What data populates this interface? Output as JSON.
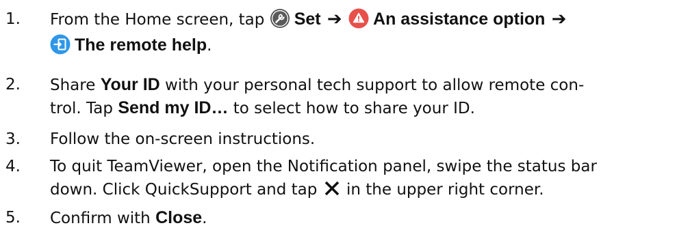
{
  "steps": [
    {
      "number": "1.",
      "line1_prefix": "From the Home screen, tap ",
      "set_label": "Set",
      "assistance_label": "An assistance option",
      "remote_label": "The remote help",
      "remote_suffix": "."
    },
    {
      "number": "2.",
      "line1_a": "Share ",
      "your_id": "Your ID",
      "line1_b": " with your personal tech support to allow remote con-",
      "line2_a": "trol. Tap ",
      "send_id": "Send my ID…",
      "line2_b": " to select how to share your ID."
    },
    {
      "number": "3.",
      "text": "Follow the on-screen instructions."
    },
    {
      "number": "4.",
      "line1": "To quit TeamViewer, open the Notification panel, swipe the status bar",
      "line2_a": "down. Click QuickSupport and tap ",
      "line2_b": " in the upper right corner."
    },
    {
      "number": "5.",
      "text_a": "Confirm with ",
      "close_label": "Close",
      "text_b": "."
    }
  ],
  "arrow_glyph": "➔",
  "icons": {
    "settings": "wrench-icon",
    "assistance": "warning-icon",
    "remote_help": "remote-login-icon",
    "close": "close-x-icon"
  },
  "colors": {
    "text": "#111111",
    "settings_icon": "#4d4d4d",
    "assistance_icon": "#e8504a",
    "remote_icon": "#2f97e8"
  }
}
